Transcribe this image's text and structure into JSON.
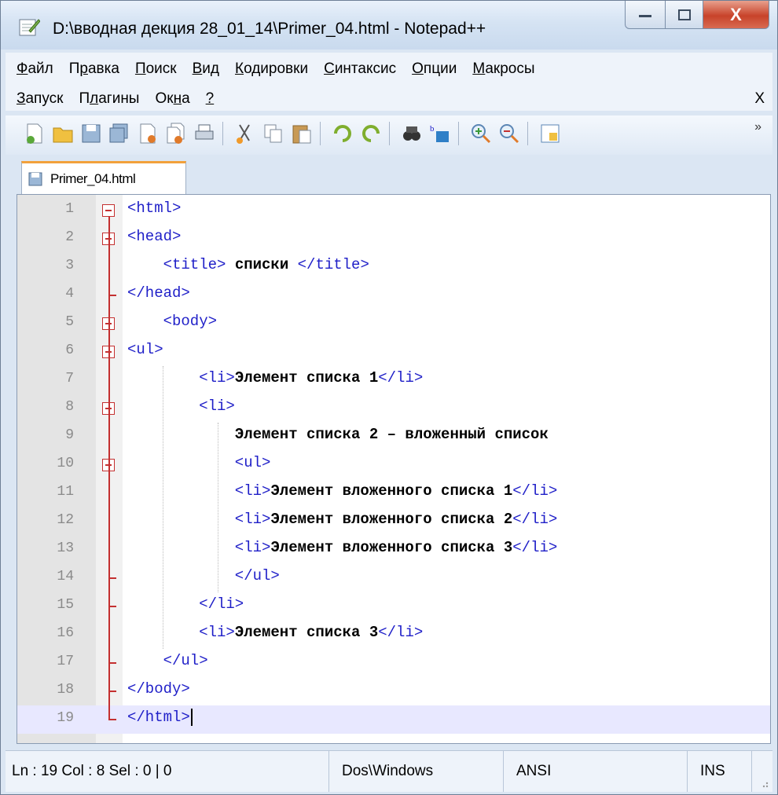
{
  "window": {
    "title": "D:\\вводная декция 28_01_14\\Primer_04.html - Notepad++",
    "close_glyph": "X"
  },
  "menu": {
    "row1": [
      "Файл",
      "Правка",
      "Поиск",
      "Вид",
      "Кодировки",
      "Синтаксис",
      "Опции",
      "Макросы"
    ],
    "row2": [
      "Запуск",
      "Плагины",
      "Окна",
      "?"
    ],
    "close_label": "X"
  },
  "toolbar": {
    "icons": [
      "new-file-icon",
      "open-file-icon",
      "save-icon",
      "save-all-icon",
      "close-icon",
      "close-all-icon",
      "print-icon",
      "cut-icon",
      "copy-icon",
      "paste-icon",
      "undo-icon",
      "redo-icon",
      "find-icon",
      "replace-icon",
      "zoom-in-icon",
      "zoom-out-icon",
      "sync-scroll-icon"
    ],
    "overflow": "»"
  },
  "tabs": [
    {
      "label": "Primer_04.html"
    }
  ],
  "editor": {
    "lines": [
      {
        "n": "1",
        "indent": 0,
        "text": "<html>"
      },
      {
        "n": "2",
        "indent": 0,
        "text": "<head>"
      },
      {
        "n": "3",
        "indent": 4,
        "text": "<title> списки </title>"
      },
      {
        "n": "4",
        "indent": 0,
        "text": "</head>"
      },
      {
        "n": "5",
        "indent": 4,
        "text": "<body>"
      },
      {
        "n": "6",
        "indent": 0,
        "text": "<ul>"
      },
      {
        "n": "7",
        "indent": 8,
        "text": "<li>Элемент списка 1</li>"
      },
      {
        "n": "8",
        "indent": 8,
        "text": "<li>"
      },
      {
        "n": "9",
        "indent": 12,
        "text": "Элемент списка 2 – вложенный список"
      },
      {
        "n": "10",
        "indent": 12,
        "text": "<ul>"
      },
      {
        "n": "11",
        "indent": 12,
        "text": "<li>Элемент вложенного списка 1</li>"
      },
      {
        "n": "12",
        "indent": 12,
        "text": "<li>Элемент вложенного списка 2</li>"
      },
      {
        "n": "13",
        "indent": 12,
        "text": "<li>Элемент вложенного списка 3</li>"
      },
      {
        "n": "14",
        "indent": 12,
        "text": "</ul>"
      },
      {
        "n": "15",
        "indent": 8,
        "text": "</li>"
      },
      {
        "n": "16",
        "indent": 8,
        "text": "<li>Элемент списка 3</li>"
      },
      {
        "n": "17",
        "indent": 4,
        "text": "</ul>"
      },
      {
        "n": "18",
        "indent": 0,
        "text": "</body>"
      },
      {
        "n": "19",
        "indent": 0,
        "text": "</html>"
      }
    ],
    "current_line": "19"
  },
  "status": {
    "position": "Ln : 19   Col : 8   Sel : 0 | 0",
    "eol": "Dos\\Windows",
    "encoding": "ANSI",
    "mode": "INS"
  },
  "colors": {
    "tag": "#1f1fc8",
    "fold": "#c43030",
    "current_line": "#e8e8ff",
    "tab_accent": "#f2a13c"
  }
}
